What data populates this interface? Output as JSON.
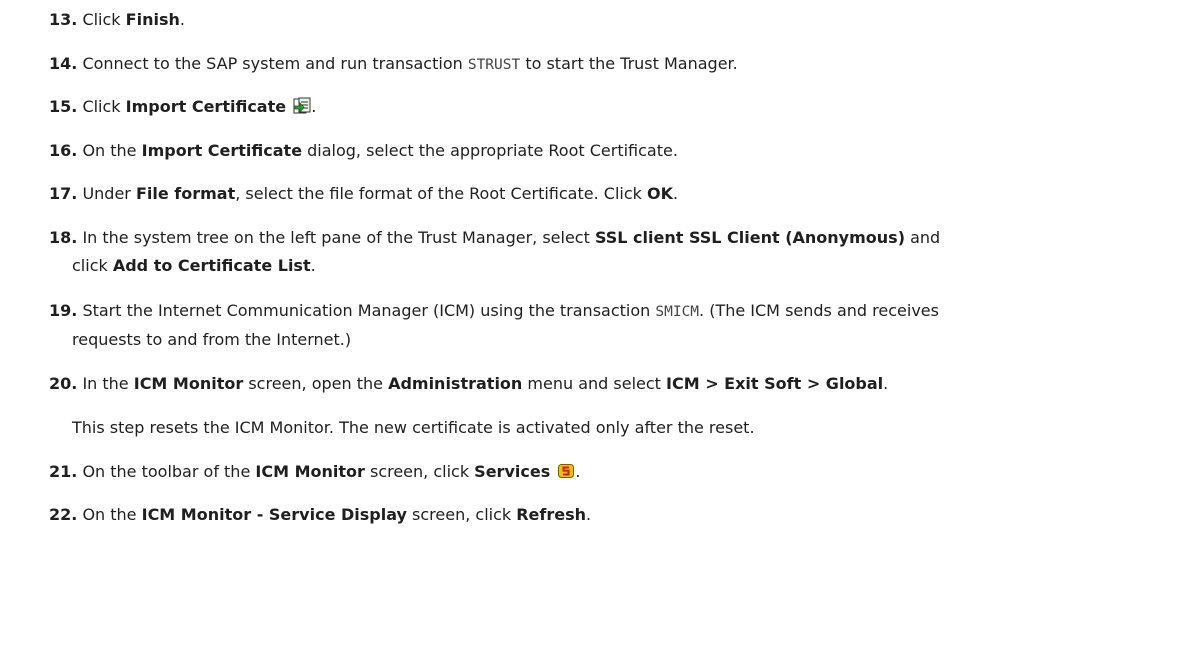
{
  "steps": [
    {
      "num": "13.",
      "parts": [
        "Click ",
        "Finish",
        "."
      ]
    },
    {
      "num": "14.",
      "parts": [
        "Connect to the SAP system and run transaction ",
        "STRUST",
        " to start the Trust Manager."
      ]
    },
    {
      "num": "15.",
      "parts": [
        "Click ",
        "Import Certificate",
        "."
      ],
      "icon": "import-certificate-icon"
    },
    {
      "num": "16.",
      "parts": [
        "On the ",
        "Import Certificate",
        " dialog, select the appropriate Root Certificate."
      ]
    },
    {
      "num": "17.",
      "parts": [
        "Under ",
        "File format",
        ", select the file format of the Root Certificate. Click ",
        "OK",
        "."
      ]
    },
    {
      "num": "18.",
      "parts": [
        "In the system tree on the left pane of the Trust Manager, select ",
        "SSL client SSL Client (Anonymous)",
        " and",
        "click ",
        "Add to Certificate List",
        "."
      ]
    },
    {
      "num": "19.",
      "parts": [
        "Start the Internet Communication Manager (ICM) using the transaction ",
        "SMICM",
        ". (The ICM sends and receives",
        "requests to and from the Internet.)"
      ]
    },
    {
      "num": "20.",
      "parts": [
        "In the ",
        "ICM Monitor",
        " screen, open the ",
        "Administration",
        " menu and select ",
        "ICM > Exit Soft > Global",
        "."
      ]
    },
    {
      "num": "",
      "parts": [
        "This step resets the ICM Monitor. The new certificate is activated only after the reset."
      ]
    },
    {
      "num": "21.",
      "parts": [
        "On the toolbar of the ",
        "ICM Monitor",
        " screen, click ",
        "Services",
        "."
      ],
      "icon": "services-icon"
    },
    {
      "num": "22.",
      "parts": [
        "On the ",
        "ICM Monitor - Service Display",
        " screen, click ",
        "Refresh",
        "."
      ]
    }
  ],
  "icons": {
    "import_certificate": "import-certificate-icon",
    "services": "services-icon"
  },
  "colors": {
    "text": "#1f1f1f",
    "code": "#444444",
    "icon_green": "#2e9e2e",
    "icon_yellow": "#f2c400",
    "icon_red": "#d01818"
  }
}
